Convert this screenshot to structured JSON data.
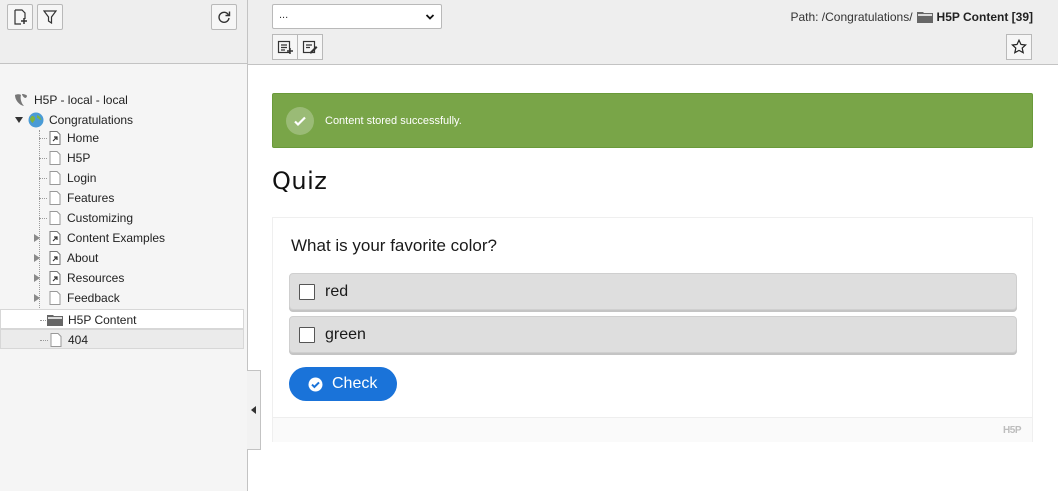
{
  "tree": {
    "root_label": "H5P - local - local",
    "site_label": "Congratulations",
    "items": [
      {
        "label": "Home",
        "type": "shortcut",
        "expandable": false
      },
      {
        "label": "H5P",
        "type": "page",
        "expandable": false
      },
      {
        "label": "Login",
        "type": "page",
        "expandable": false
      },
      {
        "label": "Features",
        "type": "page",
        "expandable": false
      },
      {
        "label": "Customizing",
        "type": "page",
        "expandable": false
      },
      {
        "label": "Content Examples",
        "type": "shortcut",
        "expandable": true
      },
      {
        "label": "About",
        "type": "shortcut",
        "expandable": true
      },
      {
        "label": "Resources",
        "type": "shortcut",
        "expandable": true
      },
      {
        "label": "Feedback",
        "type": "page",
        "expandable": true
      },
      {
        "label": "H5P Content",
        "type": "folder",
        "expandable": false,
        "selected": true
      },
      {
        "label": "404",
        "type": "page",
        "expandable": false,
        "hovered": true
      }
    ]
  },
  "toolbar": {
    "new_page_icon": "new-page-icon",
    "filter_icon": "filter-icon",
    "refresh_icon": "refresh-icon"
  },
  "header": {
    "view_select_value": "...",
    "path_prefix": "Path: /Congratulations/",
    "path_title": "H5P Content [39]"
  },
  "alert": {
    "message": "Content stored successfully.",
    "color": "#79a548"
  },
  "page_title": "Quiz",
  "h5p": {
    "question": "What is your favorite color?",
    "answers": [
      "red",
      "green"
    ],
    "check_label": "Check",
    "logo": "H5P",
    "accent": "#1a73d9"
  }
}
